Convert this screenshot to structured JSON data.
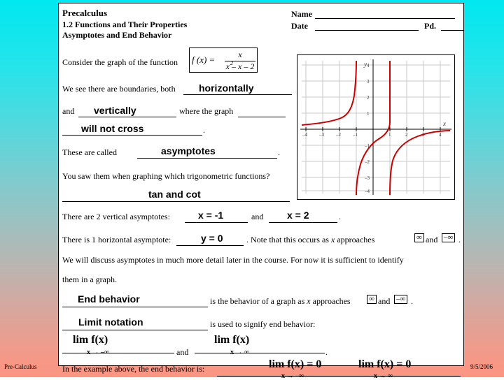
{
  "header": {
    "course": "Precalculus",
    "section": "1.2 Functions and Their Properties",
    "topic": "Asymptotes and End Behavior",
    "name_label": "Name",
    "date_label": "Date",
    "period_label": "Pd."
  },
  "body": {
    "line1": "Consider the graph of the function",
    "formula_lhs": "f (x) =",
    "formula_num": "x",
    "formula_den": "x  – x – 2",
    "formula_den_exp": "2",
    "line2": "We see there are boundaries, both",
    "answer1": "horizontally",
    "line3_and": "and",
    "answer2": "vertically",
    "line3_tail": "where the graph",
    "answer3": "will not cross",
    "line4": "These are called",
    "answer4": "asymptotes",
    "line5": "You saw them when graphing which trigonometric functions?",
    "answer5": "tan and cot",
    "line6": "There are 2 vertical asymptotes:",
    "answer6": "x = -1",
    "line6_and": "and",
    "answer7": "x = 2",
    "line7": "There is 1 horizontal asymptote:",
    "answer8": "y = 0",
    "line7_tail_a": "Note that this occurs as",
    "line7_tail_x": "x",
    "line7_tail_b": "approaches",
    "inf_pos": "∞",
    "line7_and": "and",
    "inf_neg": "–∞",
    "line8": "We will discuss asymptotes in much more detail later in the course.  For now it is sufficient to identify",
    "line9": "them in a graph.",
    "answer9": "End behavior",
    "line10_a": "is the behavior of a graph as",
    "line10_x": "x",
    "line10_b": "approaches",
    "answer10": "Limit notation",
    "line11": "is used to signify end behavior:",
    "lim1_main": "lim  f(x)",
    "lim1_sub": "x  →  –∞",
    "mid_and": "and",
    "lim2_main": "lim  f(x)",
    "lim2_sub": "x  →  ∞",
    "line12": "In the example above, the end behavior is:",
    "lim3_main": "lim  f(x) = 0",
    "lim3_sub": "x  →  –∞",
    "lim4_main": "lim  f(x) = 0",
    "lim4_sub": "x  →  ∞"
  },
  "graph": {
    "y_label": "y",
    "x_label": "x",
    "x_ticks": [
      "–4",
      "–3",
      "–2",
      "–1",
      "1",
      "2",
      "3",
      "4"
    ],
    "y_ticks": [
      "4",
      "3",
      "2",
      "1",
      "–1",
      "–2",
      "–3",
      "–4"
    ],
    "curve_color": "#cc0000"
  },
  "footer": {
    "left": "Pre-Calculus",
    "right": "9/5/2006"
  }
}
